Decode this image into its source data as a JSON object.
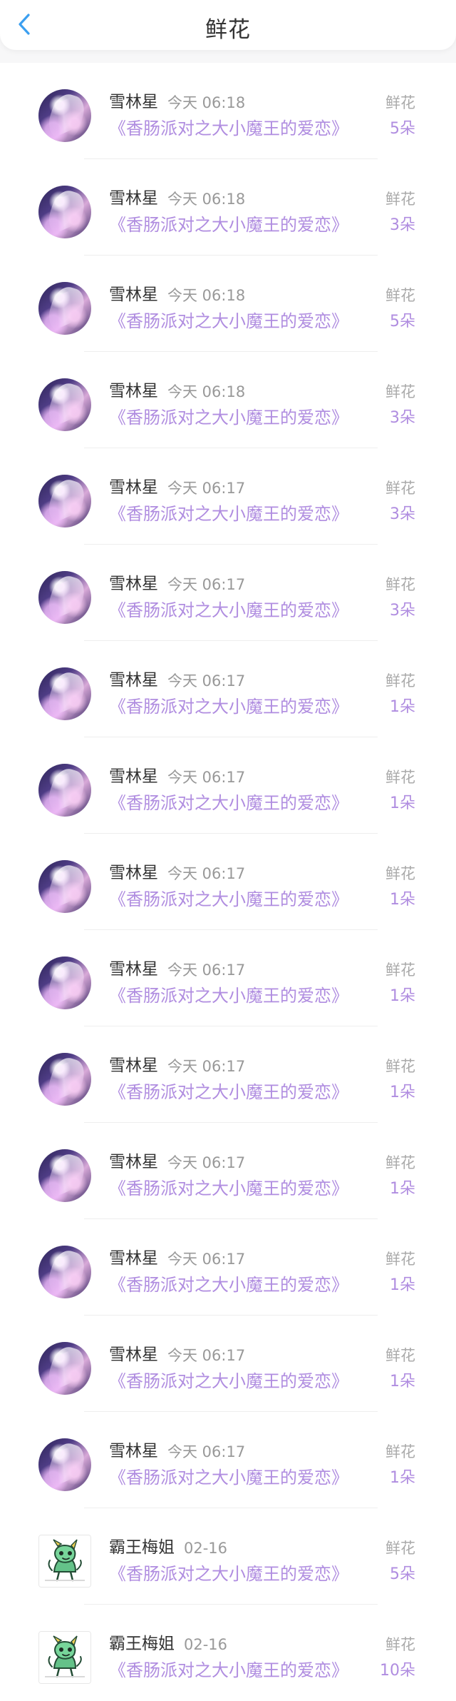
{
  "header": {
    "title": "鲜花",
    "back_icon": "chevron-left-icon",
    "accent_color": "#3b9ff0"
  },
  "colors": {
    "purple_text": "#b08de0",
    "muted_text": "#999999",
    "background": "#f7f7f8",
    "card": "#ffffff"
  },
  "items": [
    {
      "name": "雪林星",
      "time": "今天 06:18",
      "book": "《香肠派对之大小魔王的爱恋》",
      "gift": "鲜花",
      "count": "5朵",
      "avatar": "anime-girl-avatar"
    },
    {
      "name": "雪林星",
      "time": "今天 06:18",
      "book": "《香肠派对之大小魔王的爱恋》",
      "gift": "鲜花",
      "count": "3朵",
      "avatar": "anime-girl-avatar"
    },
    {
      "name": "雪林星",
      "time": "今天 06:18",
      "book": "《香肠派对之大小魔王的爱恋》",
      "gift": "鲜花",
      "count": "5朵",
      "avatar": "anime-girl-avatar"
    },
    {
      "name": "雪林星",
      "time": "今天 06:18",
      "book": "《香肠派对之大小魔王的爱恋》",
      "gift": "鲜花",
      "count": "3朵",
      "avatar": "anime-girl-avatar"
    },
    {
      "name": "雪林星",
      "time": "今天 06:17",
      "book": "《香肠派对之大小魔王的爱恋》",
      "gift": "鲜花",
      "count": "3朵",
      "avatar": "anime-girl-avatar"
    },
    {
      "name": "雪林星",
      "time": "今天 06:17",
      "book": "《香肠派对之大小魔王的爱恋》",
      "gift": "鲜花",
      "count": "3朵",
      "avatar": "anime-girl-avatar"
    },
    {
      "name": "雪林星",
      "time": "今天 06:17",
      "book": "《香肠派对之大小魔王的爱恋》",
      "gift": "鲜花",
      "count": "1朵",
      "avatar": "anime-girl-avatar"
    },
    {
      "name": "雪林星",
      "time": "今天 06:17",
      "book": "《香肠派对之大小魔王的爱恋》",
      "gift": "鲜花",
      "count": "1朵",
      "avatar": "anime-girl-avatar"
    },
    {
      "name": "雪林星",
      "time": "今天 06:17",
      "book": "《香肠派对之大小魔王的爱恋》",
      "gift": "鲜花",
      "count": "1朵",
      "avatar": "anime-girl-avatar"
    },
    {
      "name": "雪林星",
      "time": "今天 06:17",
      "book": "《香肠派对之大小魔王的爱恋》",
      "gift": "鲜花",
      "count": "1朵",
      "avatar": "anime-girl-avatar"
    },
    {
      "name": "雪林星",
      "time": "今天 06:17",
      "book": "《香肠派对之大小魔王的爱恋》",
      "gift": "鲜花",
      "count": "1朵",
      "avatar": "anime-girl-avatar"
    },
    {
      "name": "雪林星",
      "time": "今天 06:17",
      "book": "《香肠派对之大小魔王的爱恋》",
      "gift": "鲜花",
      "count": "1朵",
      "avatar": "anime-girl-avatar"
    },
    {
      "name": "雪林星",
      "time": "今天 06:17",
      "book": "《香肠派对之大小魔王的爱恋》",
      "gift": "鲜花",
      "count": "1朵",
      "avatar": "anime-girl-avatar"
    },
    {
      "name": "雪林星",
      "time": "今天 06:17",
      "book": "《香肠派对之大小魔王的爱恋》",
      "gift": "鲜花",
      "count": "1朵",
      "avatar": "anime-girl-avatar"
    },
    {
      "name": "雪林星",
      "time": "今天 06:17",
      "book": "《香肠派对之大小魔王的爱恋》",
      "gift": "鲜花",
      "count": "1朵",
      "avatar": "anime-girl-avatar"
    },
    {
      "name": "霸王梅姐",
      "time": "02-16",
      "book": "《香肠派对之大小魔王的爱恋》",
      "gift": "鲜花",
      "count": "5朵",
      "avatar": "green-dragon-avatar"
    },
    {
      "name": "霸王梅姐",
      "time": "02-16",
      "book": "《香肠派对之大小魔王的爱恋》",
      "gift": "鲜花",
      "count": "10朵",
      "avatar": "green-dragon-avatar"
    }
  ]
}
